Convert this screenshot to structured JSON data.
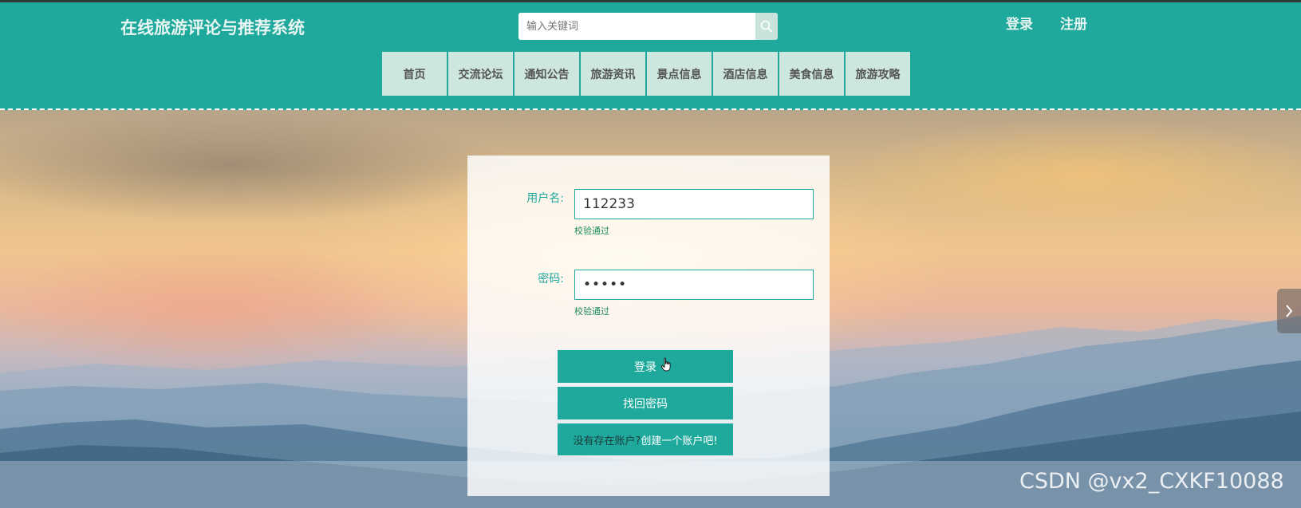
{
  "header": {
    "site_title": "在线旅游评论与推荐系统",
    "search_placeholder": "输入关键词",
    "login_link": "登录",
    "register_link": "注册"
  },
  "nav": {
    "items": [
      {
        "label": "首页"
      },
      {
        "label": "交流论坛"
      },
      {
        "label": "通知公告"
      },
      {
        "label": "旅游资讯"
      },
      {
        "label": "景点信息"
      },
      {
        "label": "酒店信息"
      },
      {
        "label": "美食信息"
      },
      {
        "label": "旅游攻略"
      }
    ]
  },
  "login_form": {
    "username_label": "用户名:",
    "username_value": "112233",
    "username_validation": "校验通过",
    "password_label": "密码:",
    "password_value": "•••••",
    "password_validation": "校验通过",
    "login_button": "登录",
    "forgot_button": "找回密码",
    "register_prompt": "没有存在账户?",
    "register_link": "创建一个账户吧!"
  },
  "watermark": "CSDN @vx2_CXKF10088",
  "colors": {
    "primary": "#1ea99c",
    "nav_bg": "#cde6de",
    "validation_text": "#1a8c5a"
  },
  "icons": {
    "search": "search-icon",
    "side_toggle": "chevron-right-icon",
    "cursor": "hand-cursor-icon"
  }
}
